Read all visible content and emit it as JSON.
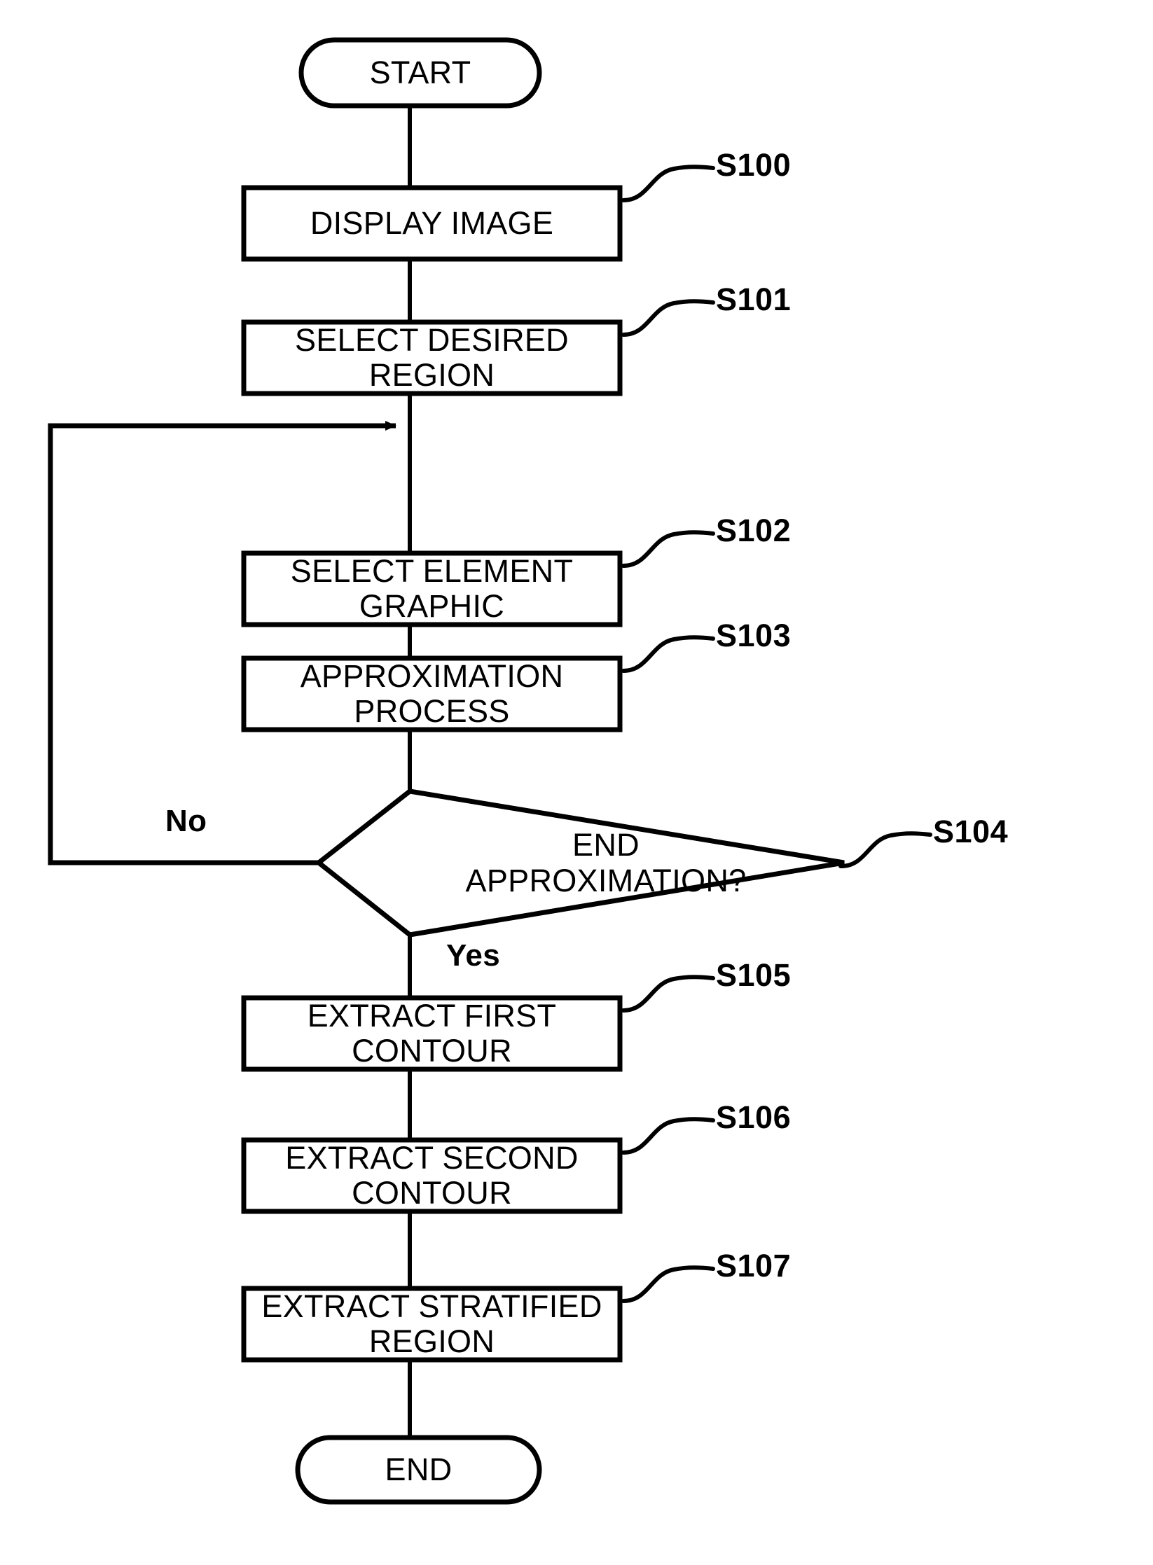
{
  "diagram": {
    "type": "flowchart",
    "orientation": "vertical",
    "stroke_color": "#000000",
    "background_color": "#ffffff"
  },
  "nodes": {
    "start": {
      "label": "START",
      "shape": "terminal"
    },
    "s100": {
      "label": "DISPLAY IMAGE",
      "shape": "process",
      "tag": "S100"
    },
    "s101": {
      "label": "SELECT DESIRED REGION",
      "shape": "process",
      "tag": "S101"
    },
    "s102": {
      "label": "SELECT ELEMENT GRAPHIC",
      "shape": "process",
      "tag": "S102"
    },
    "s103": {
      "label": "APPROXIMATION PROCESS",
      "shape": "process",
      "tag": "S103"
    },
    "s104": {
      "label": "END\nAPPROXIMATION?",
      "shape": "decision",
      "tag": "S104"
    },
    "s105": {
      "label": "EXTRACT FIRST CONTOUR",
      "shape": "process",
      "tag": "S105"
    },
    "s106": {
      "label": "EXTRACT SECOND CONTOUR",
      "shape": "process",
      "tag": "S106"
    },
    "s107": {
      "label": "EXTRACT STRATIFIED REGION",
      "shape": "process",
      "tag": "S107"
    },
    "end": {
      "label": "END",
      "shape": "terminal"
    }
  },
  "branches": {
    "no": "No",
    "yes": "Yes"
  }
}
